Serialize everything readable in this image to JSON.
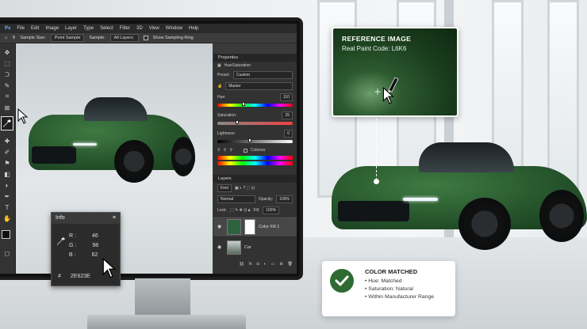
{
  "menu": [
    "File",
    "Edit",
    "Image",
    "Layer",
    "Type",
    "Select",
    "Filter",
    "3D",
    "View",
    "Window",
    "Help"
  ],
  "options": {
    "sample_size_label": "Sample Size:",
    "sample_size_value": "Point Sample",
    "sample_label": "Sample:",
    "sample_value": "All Layers",
    "show_ring": "Show Sampling Ring"
  },
  "properties": {
    "tab": "Properties",
    "adjustment": "Hue/Saturation",
    "preset_label": "Preset:",
    "preset_value": "Custom",
    "channel_value": "Master",
    "hue_label": "Hue:",
    "hue_value": "110",
    "saturation_label": "Saturation:",
    "saturation_value": "25",
    "lightness_label": "Lightness:",
    "lightness_value": "0",
    "colorize_label": "Colorize"
  },
  "layers": {
    "tab": "Layers",
    "kind": "Kind",
    "blend": "Normal",
    "opacity_label": "Opacity:",
    "opacity_value": "100%",
    "lock_label": "Lock:",
    "fill_label": "Fill:",
    "fill_value": "100%",
    "items": [
      {
        "name": "Color Fill 1"
      },
      {
        "name": "Car"
      }
    ]
  },
  "info": {
    "title": "Info",
    "r_label": "R :",
    "r_value": "46",
    "g_label": "G :",
    "g_value": "98",
    "b_label": "B :",
    "b_value": "62",
    "hex_label": "#",
    "hex_value": "2E623E"
  },
  "reference": {
    "title": "REFERENCE IMAGE",
    "subtitle": "Real Paint Code: L6K6"
  },
  "match": {
    "title": "COLOR MATCHED",
    "items": [
      "• Hue: Matched",
      "• Saturation: Natural",
      "• Within Manufacturer Range"
    ]
  },
  "car_badge": "",
  "colors": {
    "paint": "#2E623E",
    "accent": "#2e6b33"
  }
}
